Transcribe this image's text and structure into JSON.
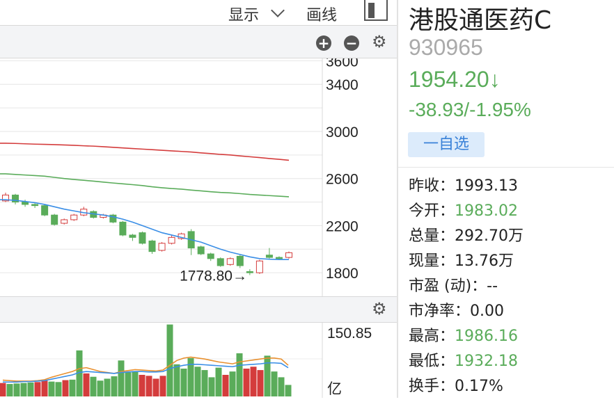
{
  "toolbar": {
    "display_label": "显示",
    "draw_label": "画线"
  },
  "stock": {
    "name": "港股通医药C",
    "code": "930965",
    "price": "1954.20↓",
    "change": "-38.93/-1.95%",
    "watchlist_label": "一自选"
  },
  "stats": [
    {
      "label": "昨收：",
      "value": "1993.13",
      "color": "#222222"
    },
    {
      "label": "今开：",
      "value": "1983.02",
      "color": "#5aac5a"
    },
    {
      "label": "总量：",
      "value": "292.70万",
      "color": "#222222"
    },
    {
      "label": "现量：",
      "value": "13.76万",
      "color": "#222222"
    },
    {
      "label": "市盈 (动)：",
      "value": "--",
      "color": "#222222"
    },
    {
      "label": "市净率：",
      "value": "0.00",
      "color": "#222222"
    },
    {
      "label": "最高：",
      "value": "1986.16",
      "color": "#5aac5a"
    },
    {
      "label": "最低：",
      "value": "1932.18",
      "color": "#5aac5a"
    },
    {
      "label": "换手：",
      "value": "0.17%",
      "color": "#222222"
    }
  ],
  "colors": {
    "up": "#d43c3c",
    "down": "#5aac5a",
    "ma_short": "#3a8ee6",
    "ma_mid": "#5aac5a",
    "ma_long": "#d43c3c",
    "vol_ma1": "#e8902f",
    "vol_ma2": "#3a8ee6"
  },
  "chart_data": [
    {
      "type": "candlestick",
      "y_ticks": [
        "3600",
        "3400",
        "3000",
        "2600",
        "2200",
        "1800"
      ],
      "y_tick_values": [
        3600,
        3400,
        3000,
        2600,
        2200,
        1800
      ],
      "ylim": [
        1600,
        3620
      ],
      "grid": true,
      "annotation": {
        "text": "1778.80→",
        "value": 1778.8
      },
      "candles": [
        {
          "o": 2410,
          "c": 2460,
          "h": 2480,
          "l": 2400
        },
        {
          "o": 2460,
          "c": 2400,
          "h": 2470,
          "l": 2380
        },
        {
          "o": 2400,
          "c": 2380,
          "h": 2420,
          "l": 2360
        },
        {
          "o": 2380,
          "c": 2370,
          "h": 2390,
          "l": 2350
        },
        {
          "o": 2370,
          "c": 2290,
          "h": 2380,
          "l": 2280
        },
        {
          "o": 2290,
          "c": 2210,
          "h": 2300,
          "l": 2200
        },
        {
          "o": 2220,
          "c": 2250,
          "h": 2260,
          "l": 2210
        },
        {
          "o": 2250,
          "c": 2290,
          "h": 2300,
          "l": 2240
        },
        {
          "o": 2290,
          "c": 2340,
          "h": 2360,
          "l": 2280
        },
        {
          "o": 2320,
          "c": 2270,
          "h": 2330,
          "l": 2260
        },
        {
          "o": 2270,
          "c": 2290,
          "h": 2300,
          "l": 2260
        },
        {
          "o": 2290,
          "c": 2230,
          "h": 2300,
          "l": 2220
        },
        {
          "o": 2230,
          "c": 2120,
          "h": 2240,
          "l": 2110
        },
        {
          "o": 2120,
          "c": 2100,
          "h": 2130,
          "l": 2070
        },
        {
          "o": 2140,
          "c": 2050,
          "h": 2150,
          "l": 2040
        },
        {
          "o": 2070,
          "c": 1980,
          "h": 2080,
          "l": 1960
        },
        {
          "o": 1990,
          "c": 2050,
          "h": 2060,
          "l": 1980
        },
        {
          "o": 2050,
          "c": 2100,
          "h": 2120,
          "l": 2040
        },
        {
          "o": 2090,
          "c": 2130,
          "h": 2140,
          "l": 2080
        },
        {
          "o": 2150,
          "c": 2010,
          "h": 2170,
          "l": 1950
        },
        {
          "o": 2020,
          "c": 1960,
          "h": 2030,
          "l": 1950
        },
        {
          "o": 1960,
          "c": 1920,
          "h": 1970,
          "l": 1900
        },
        {
          "o": 1920,
          "c": 1860,
          "h": 1930,
          "l": 1850
        },
        {
          "o": 1870,
          "c": 1920,
          "h": 1930,
          "l": 1860
        },
        {
          "o": 1940,
          "c": 1860,
          "h": 1950,
          "l": 1840
        },
        {
          "o": 1810,
          "c": 1800,
          "h": 1830,
          "l": 1780
        },
        {
          "o": 1800,
          "c": 1900,
          "h": 1910,
          "l": 1790
        },
        {
          "o": 1950,
          "c": 1930,
          "h": 2010,
          "l": 1920
        },
        {
          "o": 1930,
          "c": 1920,
          "h": 1940,
          "l": 1910
        },
        {
          "o": 1930,
          "c": 1970,
          "h": 1980,
          "l": 1920
        }
      ],
      "ma_short": [
        2420,
        2415,
        2405,
        2395,
        2380,
        2360,
        2340,
        2325,
        2310,
        2300,
        2290,
        2275,
        2255,
        2230,
        2200,
        2170,
        2140,
        2120,
        2100,
        2080,
        2060,
        2030,
        2000,
        1975,
        1955,
        1935,
        1920,
        1915,
        1912,
        1912
      ],
      "ma_mid": [
        2640,
        2635,
        2630,
        2625,
        2620,
        2610,
        2600,
        2592,
        2585,
        2578,
        2570,
        2562,
        2555,
        2548,
        2540,
        2530,
        2522,
        2515,
        2510,
        2502,
        2495,
        2488,
        2482,
        2478,
        2472,
        2465,
        2460,
        2455,
        2450,
        2445
      ],
      "ma_long": [
        2900,
        2898,
        2895,
        2892,
        2890,
        2888,
        2885,
        2882,
        2878,
        2875,
        2870,
        2865,
        2860,
        2855,
        2850,
        2845,
        2840,
        2835,
        2830,
        2825,
        2818,
        2812,
        2805,
        2800,
        2792,
        2785,
        2778,
        2770,
        2763,
        2755
      ]
    },
    {
      "type": "bar",
      "y_ticks": [
        "150.85",
        "亿"
      ],
      "ylim": [
        0,
        150.85
      ],
      "values": [
        28,
        26,
        27,
        28,
        29,
        30,
        33,
        31,
        30,
        34,
        35,
        96,
        48,
        41,
        33,
        37,
        42,
        75,
        50,
        53,
        45,
        43,
        37,
        43,
        150,
        67,
        58,
        80,
        62,
        55,
        40,
        60,
        45,
        52,
        90,
        58,
        62,
        55,
        85,
        52,
        40,
        24
      ],
      "up_down": [
        "u",
        "d",
        "d",
        "d",
        "d",
        "u",
        "u",
        "d",
        "d",
        "u",
        "d",
        "d",
        "u",
        "d",
        "d",
        "d",
        "d",
        "d",
        "d",
        "d",
        "u",
        "u",
        "u",
        "u",
        "d",
        "d",
        "d",
        "d",
        "d",
        "d",
        "d",
        "d",
        "u",
        "d",
        "d",
        "u",
        "u",
        "u",
        "d",
        "d",
        "d",
        "d"
      ],
      "ma1": [
        34,
        33,
        32,
        32,
        32,
        33,
        35,
        40,
        44,
        48,
        52,
        58,
        60,
        56,
        52,
        50,
        48,
        52,
        54,
        56,
        55,
        54,
        53,
        55,
        65,
        75,
        80,
        82,
        80,
        78,
        75,
        72,
        70,
        68,
        72,
        74,
        76,
        78,
        80,
        80,
        78,
        65
      ],
      "ma2": [
        30,
        30,
        30,
        31,
        31,
        32,
        33,
        36,
        39,
        42,
        45,
        50,
        52,
        51,
        50,
        49,
        48,
        50,
        51,
        52,
        52,
        51,
        51,
        52,
        58,
        62,
        65,
        67,
        67,
        66,
        65,
        64,
        63,
        62,
        65,
        66,
        67,
        68,
        70,
        70,
        69,
        60
      ]
    }
  ]
}
